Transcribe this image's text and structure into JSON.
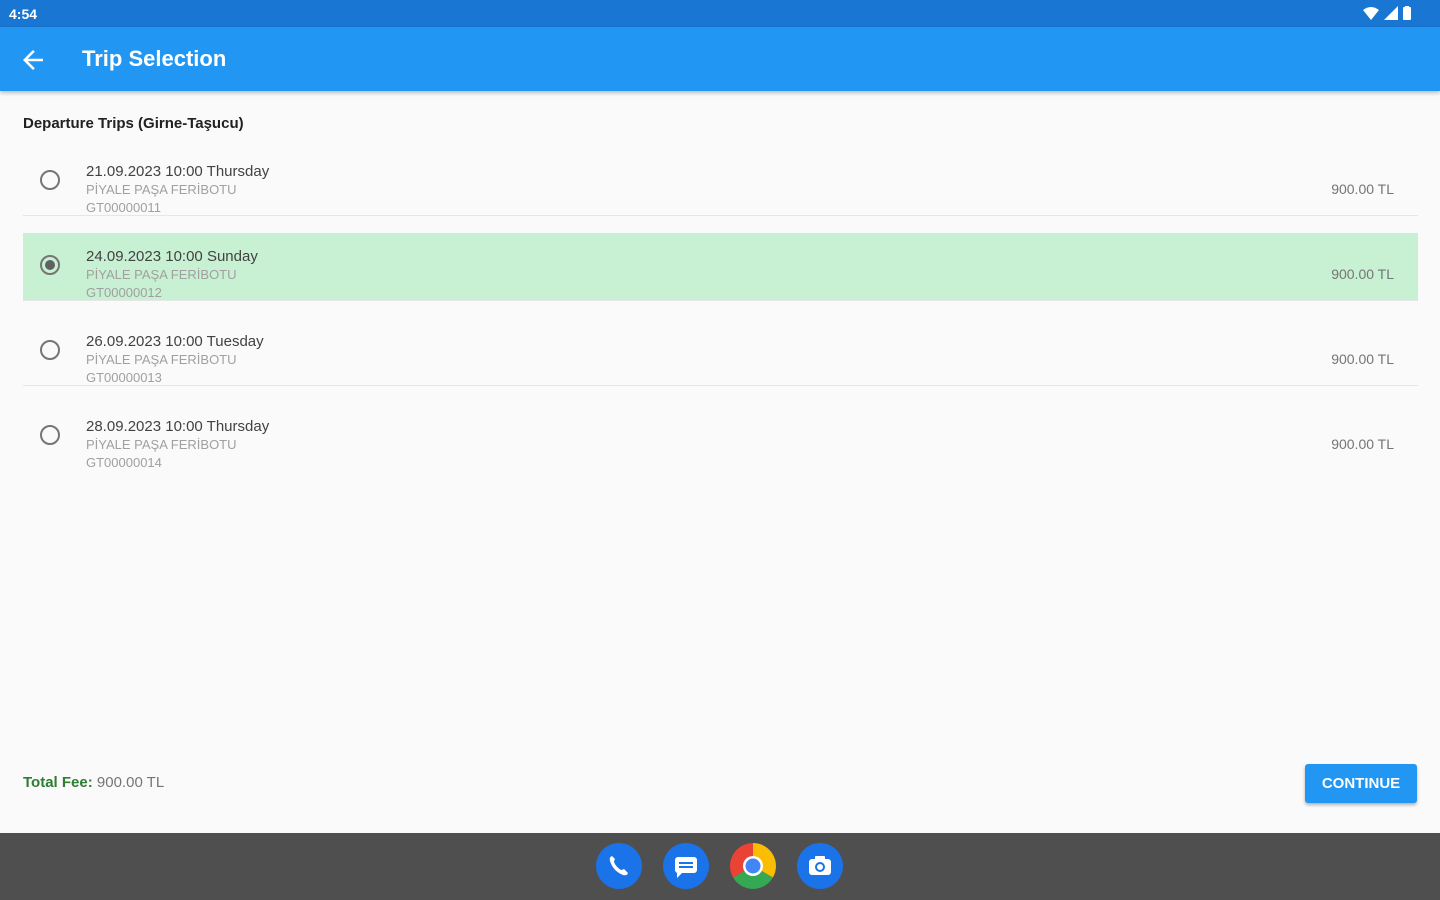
{
  "status_bar": {
    "time": "4:54"
  },
  "app_bar": {
    "title": "Trip Selection"
  },
  "section": {
    "title": "Departure Trips (Girne-Taşucu)"
  },
  "trips": [
    {
      "date": "21.09.2023 10:00 Thursday",
      "ship": "PİYALE PAŞA FERİBOTU",
      "code": "GT00000011",
      "price": "900.00 TL",
      "selected": false
    },
    {
      "date": "24.09.2023 10:00 Sunday",
      "ship": "PİYALE PAŞA FERİBOTU",
      "code": "GT00000012",
      "price": "900.00 TL",
      "selected": true
    },
    {
      "date": "26.09.2023 10:00 Tuesday",
      "ship": "PİYALE PAŞA FERİBOTU",
      "code": "GT00000013",
      "price": "900.00 TL",
      "selected": false
    },
    {
      "date": "28.09.2023 10:00 Thursday",
      "ship": "PİYALE PAŞA FERİBOTU",
      "code": "GT00000014",
      "price": "900.00 TL",
      "selected": false
    }
  ],
  "footer": {
    "fee_label": "Total Fee:",
    "fee_value": "900.00 TL",
    "continue_label": "CONTINUE"
  },
  "dock": {
    "apps": [
      "phone-icon",
      "messages-icon",
      "chrome-icon",
      "camera-icon"
    ]
  },
  "colors": {
    "primary": "#2196f3",
    "status_bar": "#1976d2",
    "selected_row": "#c8f0d2",
    "fee_label": "#2e7d32"
  }
}
